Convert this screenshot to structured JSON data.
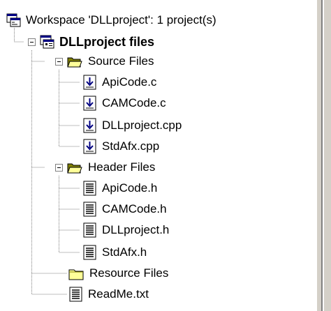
{
  "tree": {
    "workspace": {
      "label": "Workspace 'DLLproject': 1 project(s)",
      "icon": "workspace-icon"
    },
    "project": {
      "label": "DLLproject files",
      "icon": "project-icon"
    },
    "source_folder": {
      "label": "Source Files",
      "icon": "folder-open-icon"
    },
    "source_files": [
      "ApiCode.c",
      "CAMCode.c",
      "DLLproject.cpp",
      "StdAfx.cpp"
    ],
    "header_folder": {
      "label": "Header Files",
      "icon": "folder-open-icon"
    },
    "header_files": [
      "ApiCode.h",
      "CAMCode.h",
      "DLLproject.h",
      "StdAfx.h"
    ],
    "resource_folder": {
      "label": "Resource Files",
      "icon": "folder-icon"
    },
    "readme": {
      "label": "ReadMe.txt",
      "icon": "text-file-icon"
    }
  },
  "colors": {
    "folder_yellow": "#ffff99",
    "folder_dark": "#808000",
    "source_blue": "#000080",
    "window_bg": "#d4d0c8"
  }
}
